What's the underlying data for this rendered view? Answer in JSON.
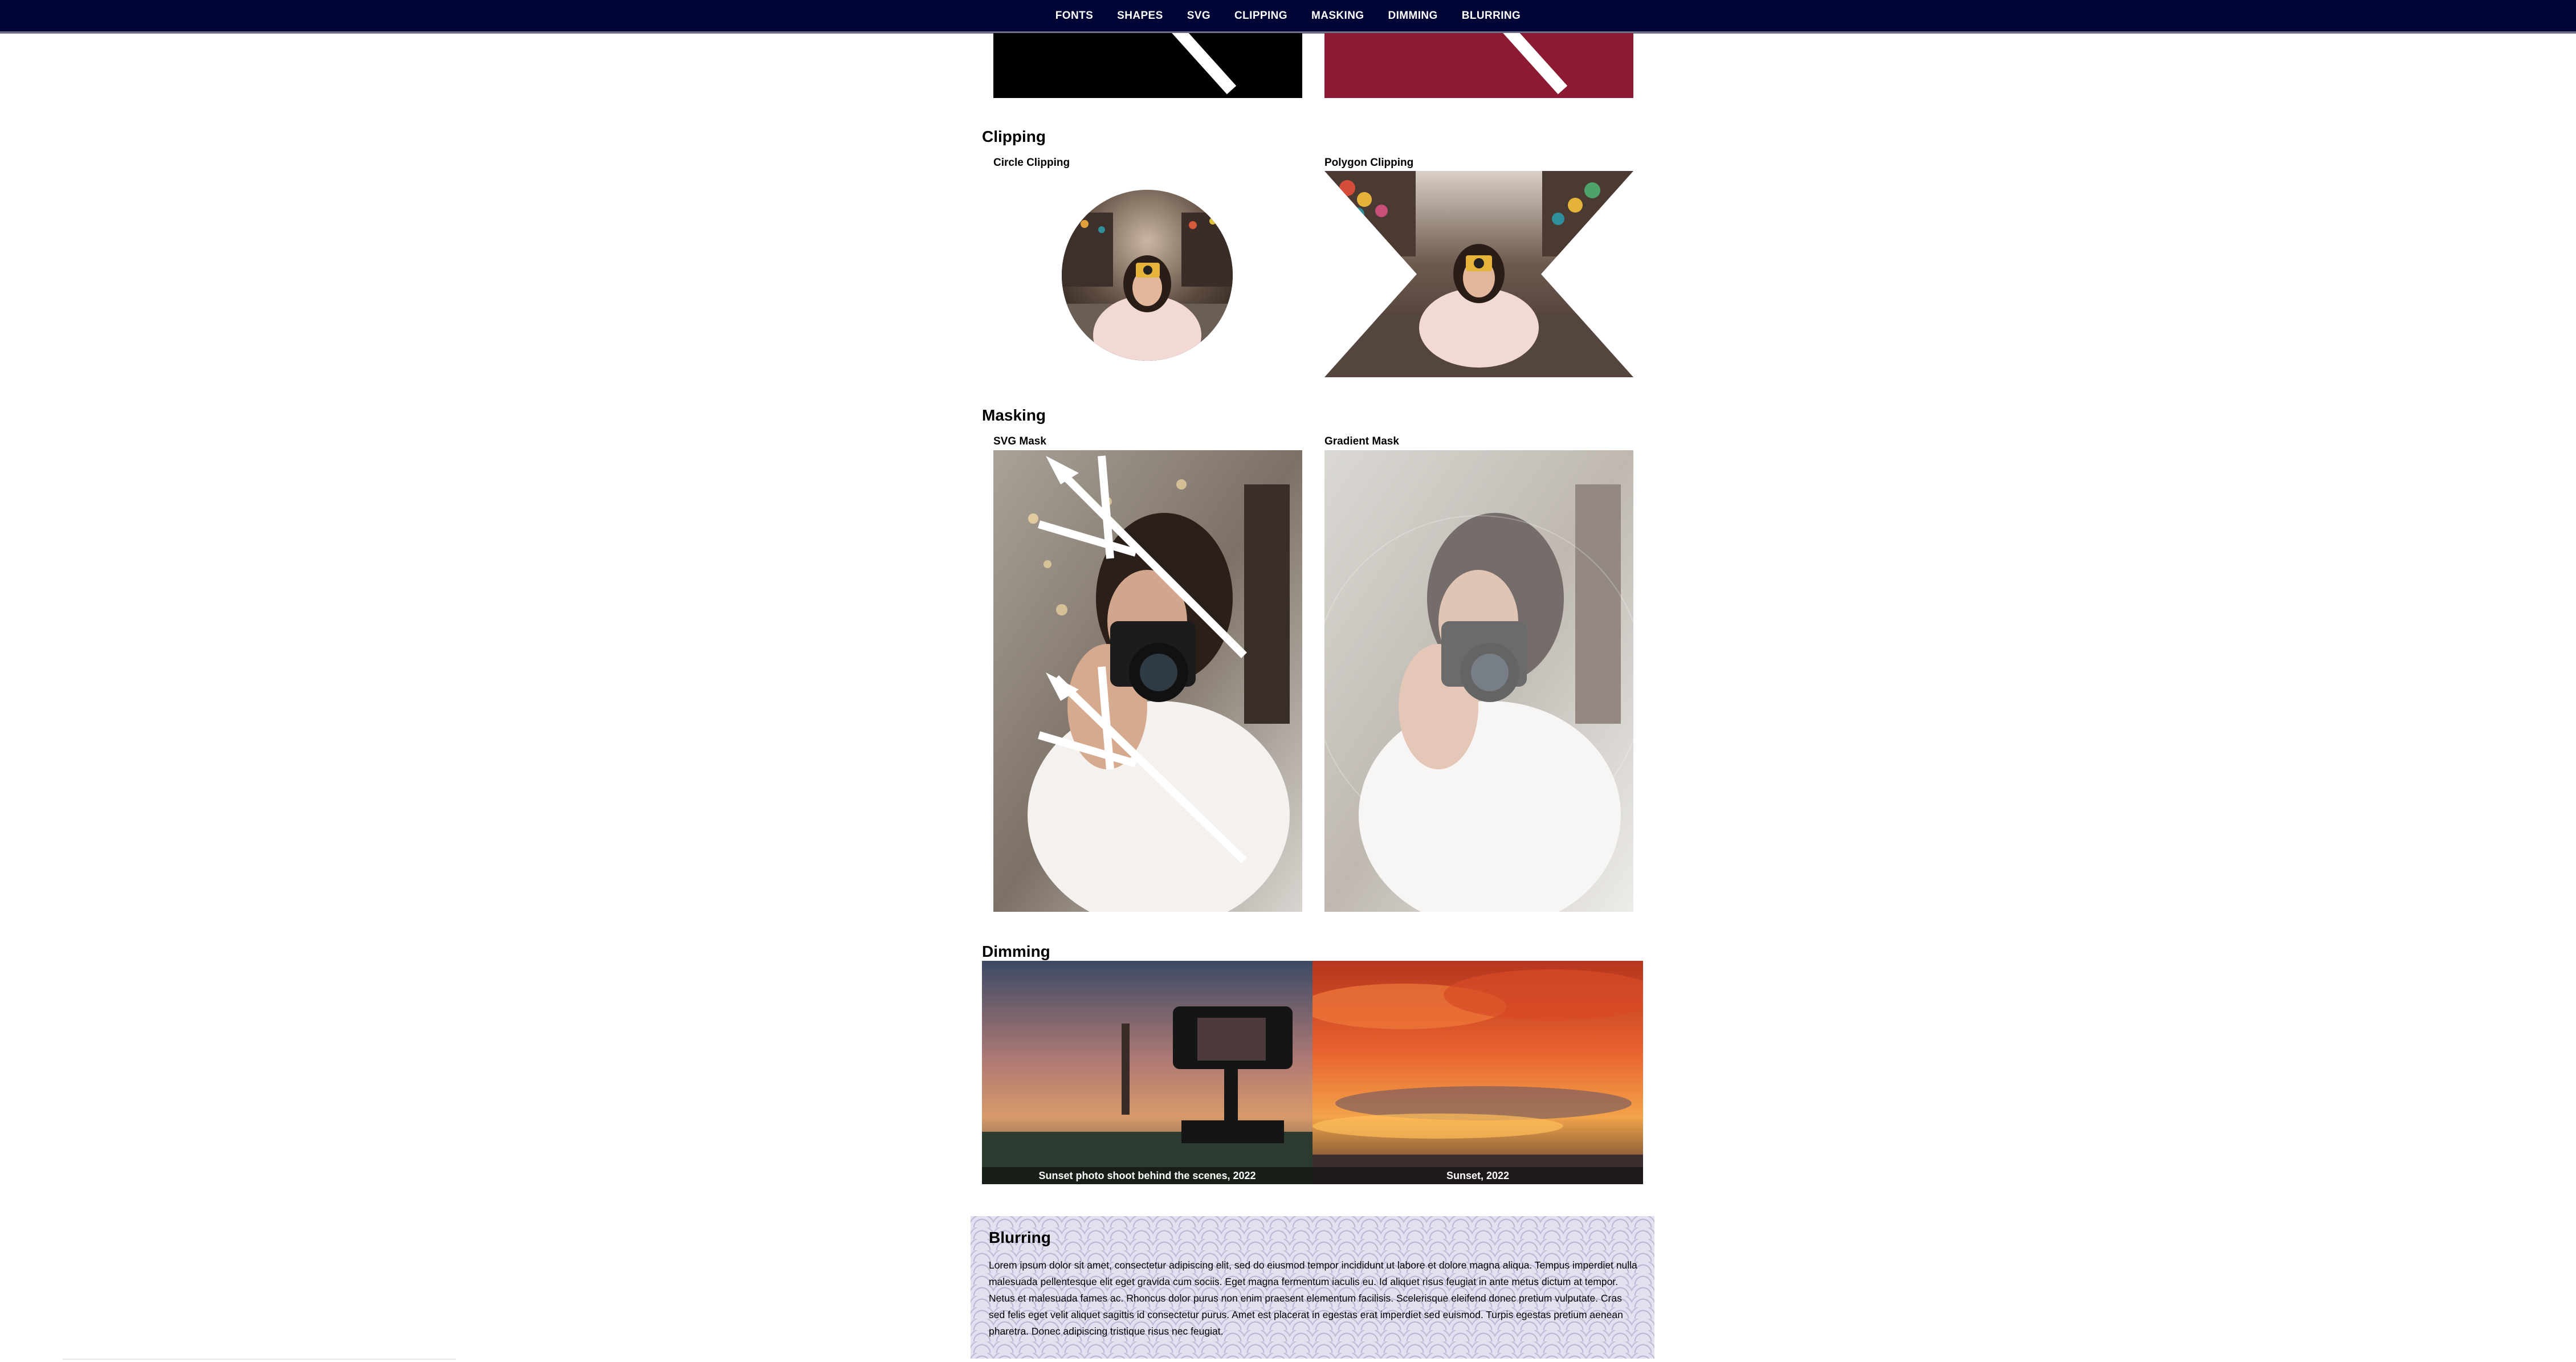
{
  "nav": {
    "items": [
      {
        "label": "FONTS"
      },
      {
        "label": "SHAPES"
      },
      {
        "label": "SVG"
      },
      {
        "label": "CLIPPING"
      },
      {
        "label": "MASKING"
      },
      {
        "label": "DIMMING"
      },
      {
        "label": "BLURRING"
      }
    ]
  },
  "colors": {
    "nav_bg": "#000536",
    "svg_box_dark": "#000000",
    "svg_box_accent": "#8b1a32"
  },
  "clipping": {
    "heading": "Clipping",
    "circle_label": "Circle Clipping",
    "polygon_label": "Polygon Clipping"
  },
  "masking": {
    "heading": "Masking",
    "svg_mask_label": "SVG Mask",
    "gradient_mask_label": "Gradient Mask"
  },
  "dimming": {
    "heading": "Dimming",
    "captions": [
      "Sunset photo shoot behind the scenes, 2022",
      "Sunset, 2022"
    ]
  },
  "blurring": {
    "heading": "Blurring",
    "body": "Lorem ipsum dolor sit amet, consectetur adipiscing elit, sed do eiusmod tempor incididunt ut labore et dolore magna aliqua. Tempus imperdiet nulla malesuada pellentesque elit eget gravida cum sociis. Eget magna fermentum iaculis eu. Id aliquet risus feugiat in ante metus dictum at tempor. Netus et malesuada fames ac. Rhoncus dolor purus non enim praesent elementum facilisis. Scelerisque eleifend donec pretium vulputate. Cras sed felis eget velit aliquet sagittis id consectetur purus. Amet est placerat in egestas erat imperdiet sed euismod. Turpis egestas pretium aenean pharetra. Donec adipiscing tristique risus nec feugiat."
  }
}
